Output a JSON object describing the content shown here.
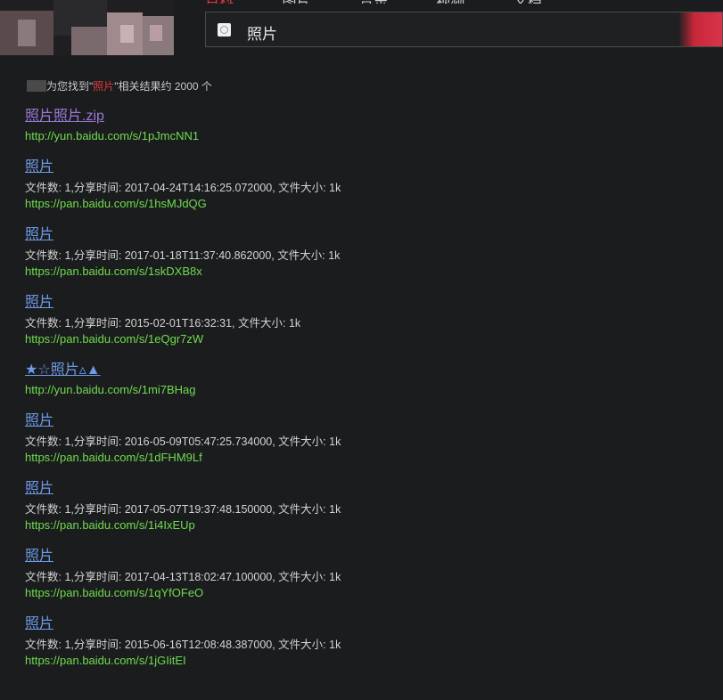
{
  "header": {
    "nav_items": [
      "百科",
      "图片",
      "音乐",
      "视频",
      "文档"
    ],
    "search_query": "照片"
  },
  "summary": {
    "prefix": "为您找到\"",
    "keyword": "照片",
    "suffix": "\"相关结果约 2000 个"
  },
  "results": [
    {
      "title": "照片照片.zip",
      "visited": true,
      "meta": "",
      "url": "http://yun.baidu.com/s/1pJmcNN1"
    },
    {
      "title": "照片",
      "visited": false,
      "meta": "文件数: 1,分享时间: 2017-04-24T14:16:25.072000, 文件大小: 1k",
      "url": "https://pan.baidu.com/s/1hsMJdQG"
    },
    {
      "title": "照片",
      "visited": false,
      "meta": "文件数: 1,分享时间: 2017-01-18T11:37:40.862000, 文件大小: 1k",
      "url": "https://pan.baidu.com/s/1skDXB8x"
    },
    {
      "title": "照片",
      "visited": false,
      "meta": "文件数: 1,分享时间: 2015-02-01T16:32:31, 文件大小: 1k",
      "url": "https://pan.baidu.com/s/1eQgr7zW"
    },
    {
      "title": "★☆照片▵▲",
      "visited": false,
      "meta": "",
      "url": "http://yun.baidu.com/s/1mi7BHag"
    },
    {
      "title": "照片",
      "visited": false,
      "meta": "文件数: 1,分享时间: 2016-05-09T05:47:25.734000, 文件大小: 1k",
      "url": "https://pan.baidu.com/s/1dFHM9Lf"
    },
    {
      "title": "照片",
      "visited": false,
      "meta": "文件数: 1,分享时间: 2017-05-07T19:37:48.150000, 文件大小: 1k",
      "url": "https://pan.baidu.com/s/1i4IxEUp"
    },
    {
      "title": "照片",
      "visited": false,
      "meta": "文件数: 1,分享时间: 2017-04-13T18:02:47.100000, 文件大小: 1k",
      "url": "https://pan.baidu.com/s/1qYfOFeO"
    },
    {
      "title": "照片",
      "visited": false,
      "meta": "文件数: 1,分享时间: 2015-06-16T12:08:48.387000, 文件大小: 1k",
      "url": "https://pan.baidu.com/s/1jGIitEI"
    }
  ]
}
